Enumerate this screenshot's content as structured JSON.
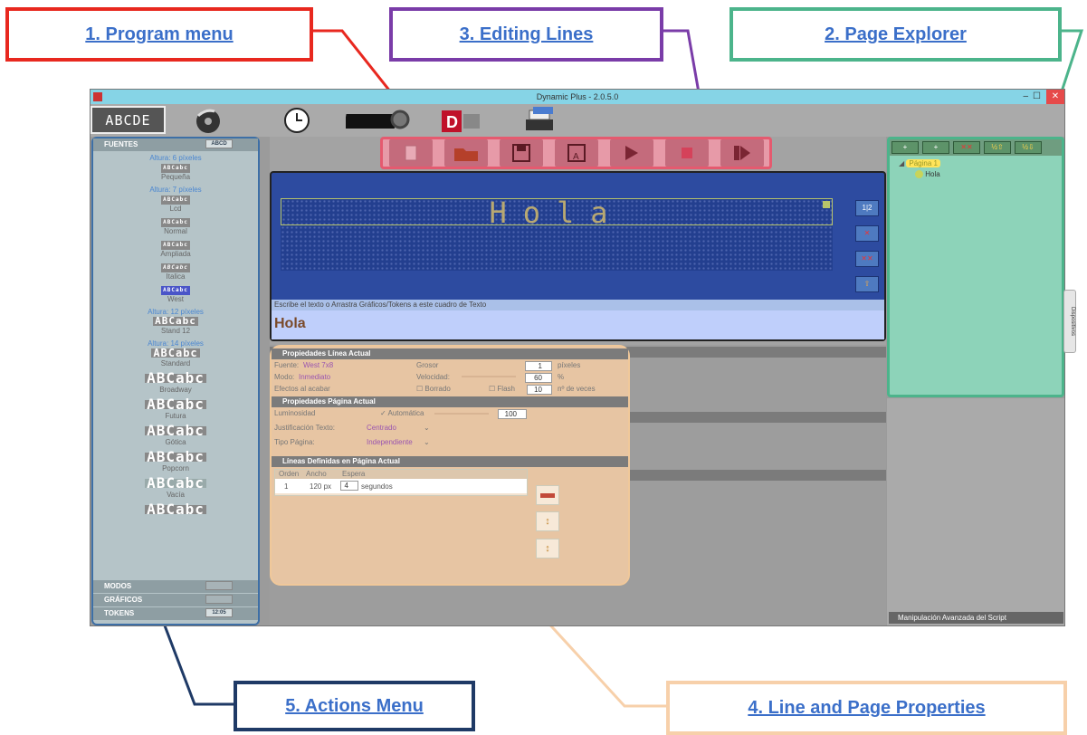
{
  "callouts": {
    "program_menu": "1. Program menu",
    "page_explorer": "2. Page Explorer",
    "editing_lines": "3. Editing Lines",
    "line_page_properties": "4. Line and Page Properties",
    "actions_menu": "5. Actions Menu"
  },
  "window": {
    "title": "Dynamic Plus - 2.0.5.0",
    "controls": [
      "–",
      "☐",
      "✕"
    ]
  },
  "toolbar": {
    "icons": [
      "abcde-display-icon",
      "disc-icon",
      "clock-icon",
      "led-panel-gear-icon",
      "dynamic-logo-icon",
      "printer-stack-icon"
    ],
    "first_label": "ABCDE"
  },
  "left_panel": {
    "fuentes_label": "FUENTES",
    "fuentes_badge": "ABCD",
    "groups": [
      {
        "height": "Altura: 6 píxeles",
        "fonts": [
          "Pequeña"
        ]
      },
      {
        "height": "Altura: 7 píxeles",
        "fonts": [
          "Lcd",
          "Normal",
          "Ampliada",
          "Italica",
          "West"
        ]
      },
      {
        "height": "Altura: 12 píxeles",
        "fonts": [
          "Stand 12"
        ]
      },
      {
        "height": "Altura: 14 píxeles",
        "fonts": [
          "Standard"
        ]
      },
      {
        "height": "",
        "fonts": [
          "Broadway",
          "Futura",
          "Gótica",
          "Popcorn",
          "Vacía"
        ]
      }
    ],
    "sample": "ABCabc",
    "modos_label": "MODOS",
    "graficos_label": "GRÁFICOS",
    "tokens_label": "TOKENS",
    "tokens_badge": "12:05"
  },
  "editor": {
    "led_text": "Hola",
    "hint": "Escribe el texto o Arrastra Gráficos/Tokens a este cuadro de Texto",
    "input_value": "Hola",
    "side_buttons": [
      "1|2",
      "✕",
      "✕✕",
      "⇧",
      "⇩"
    ]
  },
  "line_props": {
    "section": "Propiedades Línea Actual",
    "fuente_label": "Fuente:",
    "fuente_value": "West 7x8",
    "modo_label": "Modo:",
    "modo_value": "Inmediato",
    "efectos_label": "Efectos al acabar",
    "grosor_label": "Grosor",
    "grosor_value": "1",
    "grosor_unit": "píxeles",
    "velocidad_label": "Velocidad:",
    "velocidad_value": "60",
    "velocidad_unit": "%",
    "borrado_label": "Borrado",
    "flash_label": "Flash",
    "flash_value": "10",
    "flash_unit": "nº de veces"
  },
  "page_props": {
    "section": "Propiedades Página Actual",
    "luminosidad_label": "Luminosidad",
    "auto_label": "Automática",
    "luminosidad_value": "100",
    "just_label": "Justificación Texto:",
    "just_value": "Centrado",
    "tipo_label": "Tipo Página:",
    "tipo_value": "Independiente"
  },
  "lines_defined": {
    "section": "Líneas Definidas en Página Actual",
    "headers": [
      "Orden",
      "Ancho",
      "Espera"
    ],
    "rows": [
      {
        "orden": "1",
        "ancho": "120 px",
        "espera": "4",
        "unit": "segundos"
      }
    ]
  },
  "page_explorer": {
    "page": "Página 1",
    "line": "Hola",
    "tools": [
      "+",
      "+",
      "✕✕",
      "½⇧",
      "½⇩"
    ]
  },
  "script_label": "Manipulación Avanzada del Script",
  "dispositivos_label": "Dispositivos"
}
